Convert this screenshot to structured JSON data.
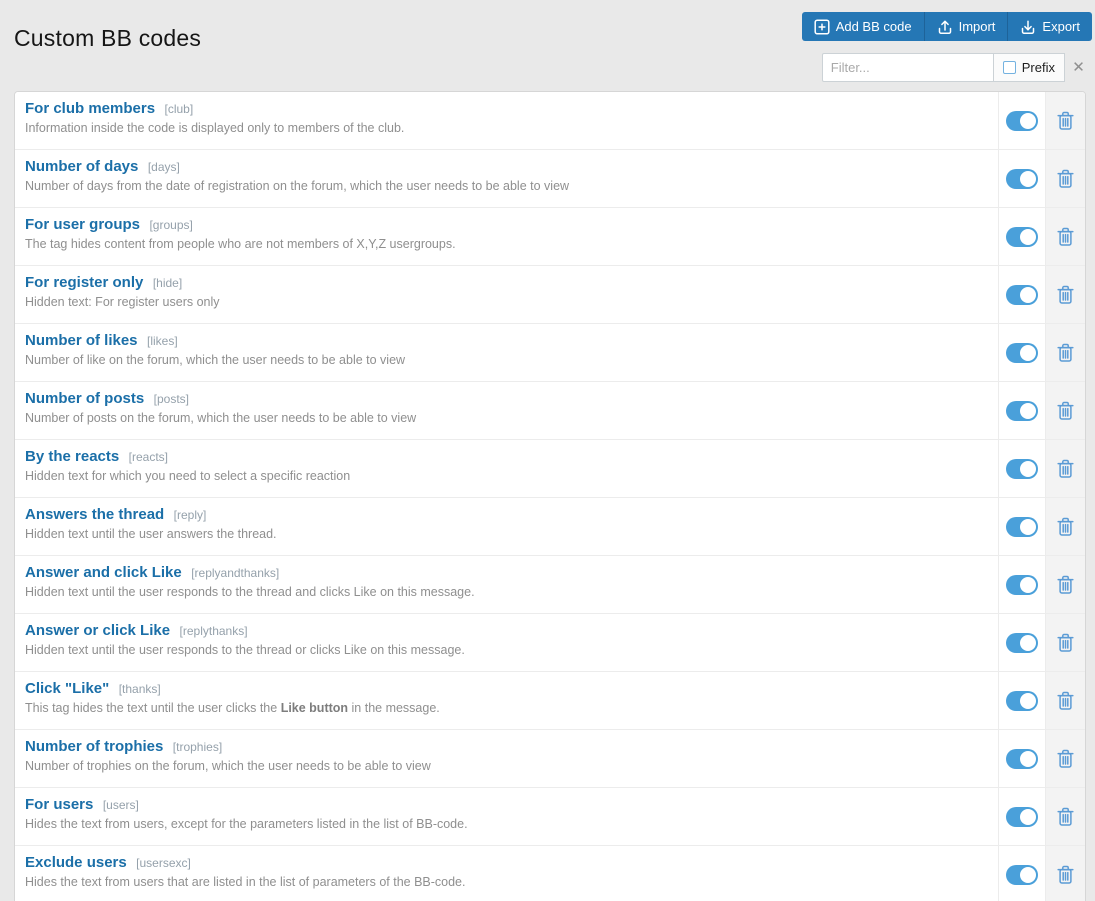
{
  "page": {
    "title": "Custom BB codes"
  },
  "toolbar": {
    "add_label": "Add BB code",
    "import_label": "Import",
    "export_label": "Export"
  },
  "filter": {
    "placeholder": "Filter...",
    "prefix_label": "Prefix",
    "clear_glyph": "✕"
  },
  "colors": {
    "accent_blue": "#2577b5",
    "row_title_blue": "#1b6fa8",
    "toggle_on_blue": "#4aa0da",
    "trash_icon_blue": "#5b9bd5",
    "page_background": "#e9e9e9",
    "delete_column_background": "#f3f3f3"
  },
  "rows": [
    {
      "title": "For club members",
      "tag": "[club]",
      "desc": "Information inside the code is displayed only to members of the club.",
      "enabled": true
    },
    {
      "title": "Number of days",
      "tag": "[days]",
      "desc": "Number of days from the date of registration on the forum, which the user needs to be able to view",
      "enabled": true
    },
    {
      "title": "For user groups",
      "tag": "[groups]",
      "desc": "The tag hides content from people who are not members of X,Y,Z usergroups.",
      "enabled": true
    },
    {
      "title": "For register only",
      "tag": "[hide]",
      "desc": "Hidden text: For register users only",
      "enabled": true
    },
    {
      "title": "Number of likes",
      "tag": "[likes]",
      "desc": "Number of like on the forum, which the user needs to be able to view",
      "enabled": true
    },
    {
      "title": "Number of posts",
      "tag": "[posts]",
      "desc": "Number of posts on the forum, which the user needs to be able to view",
      "enabled": true
    },
    {
      "title": "By the reacts",
      "tag": "[reacts]",
      "desc": "Hidden text for which you need to select a specific reaction",
      "enabled": true
    },
    {
      "title": "Answers the thread",
      "tag": "[reply]",
      "desc": "Hidden text until the user answers the thread.",
      "enabled": true
    },
    {
      "title": "Answer and click Like",
      "tag": "[replyandthanks]",
      "desc": "Hidden text until the user responds to the thread and clicks Like on this message.",
      "enabled": true
    },
    {
      "title": "Answer or click Like",
      "tag": "[replythanks]",
      "desc": "Hidden text until the user responds to the thread or clicks Like on this message.",
      "enabled": true
    },
    {
      "title": "Click \"Like\"",
      "tag": "[thanks]",
      "desc": [
        {
          "text": "This tag hides the text until the user clicks the "
        },
        {
          "text": "Like button",
          "bold": true
        },
        {
          "text": " in the message."
        }
      ],
      "enabled": true
    },
    {
      "title": "Number of trophies",
      "tag": "[trophies]",
      "desc": "Number of trophies on the forum, which the user needs to be able to view",
      "enabled": true
    },
    {
      "title": "For users",
      "tag": "[users]",
      "desc": "Hides the text from users, except for the parameters listed in the list of BB-code.",
      "enabled": true
    },
    {
      "title": "Exclude users",
      "tag": "[usersexc]",
      "desc": "Hides the text from users that are listed in the list of parameters of the BB-code.",
      "enabled": true
    }
  ]
}
